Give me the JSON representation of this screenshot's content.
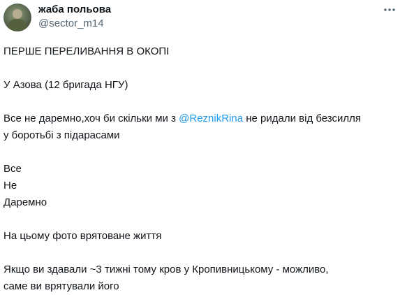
{
  "author": {
    "display_name": "жаба польова",
    "handle": "@sector_m14",
    "avatar_icon": "user-avatar-image"
  },
  "more_icon": "more-horizontal-icon",
  "colors": {
    "text": "#0f1419",
    "secondary": "#536471",
    "link": "#1d9bf0"
  },
  "tweet": {
    "line1": "ПЕРШЕ ПЕРЕЛИВАННЯ В ОКОПІ",
    "line2": "У Азова (12 бригада НГУ)",
    "line3_before": "Все не даремно,хоч би скільки ми з ",
    "line3_mention": "@ReznikRina",
    "line3_after": " не ридали від безсилля",
    "line4": "у боротьбі з підарасами",
    "line5": "Все",
    "line6": "Не",
    "line7": "Даремно",
    "line8": "На цьому фото врятоване життя",
    "line9": "Якщо ви здавали ~3 тижні тому кров у Кропивницькому - можливо,",
    "line10": "саме ви врятували його"
  }
}
